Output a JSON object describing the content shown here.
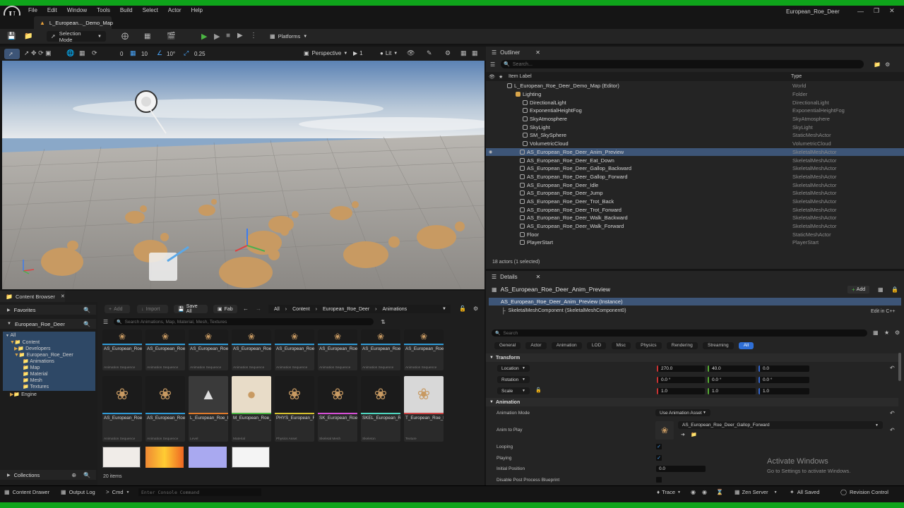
{
  "window": {
    "title": "European_Roe_Deer",
    "menu": [
      "File",
      "Edit",
      "Window",
      "Tools",
      "Build",
      "Select",
      "Actor",
      "Help"
    ]
  },
  "tab": {
    "label": "L_European..._Demo_Map"
  },
  "toolbar": {
    "selection_mode": "Selection Mode",
    "platforms": "Platforms"
  },
  "viewport_toolbar": {
    "rot_snap": "0",
    "angle": "10",
    "rot_angle": "10°",
    "scale": "0.25",
    "perspective": "Perspective",
    "camera_speed": "1",
    "lit": "Lit"
  },
  "outliner": {
    "title": "Outliner",
    "search_placeholder": "Search...",
    "col_label": "Item Label",
    "col_type": "Type",
    "rows": [
      {
        "label": "L_European_Roe_Deer_Demo_Map (Editor)",
        "type": "World"
      },
      {
        "label": "Lighting",
        "type": "Folder"
      },
      {
        "label": "DirectionalLight",
        "type": "DirectionalLight"
      },
      {
        "label": "ExponentialHeightFog",
        "type": "ExponentialHeightFog"
      },
      {
        "label": "SkyAtmosphere",
        "type": "SkyAtmosphere"
      },
      {
        "label": "SkyLight",
        "type": "SkyLight"
      },
      {
        "label": "SM_SkySphere",
        "type": "StaticMeshActor"
      },
      {
        "label": "VolumetricCloud",
        "type": "VolumetricCloud"
      },
      {
        "label": "AS_European_Roe_Deer_Anim_Preview",
        "type": "SkeletalMeshActor"
      },
      {
        "label": "AS_European_Roe_Deer_Eat_Down",
        "type": "SkeletalMeshActor"
      },
      {
        "label": "AS_European_Roe_Deer_Gallop_Backward",
        "type": "SkeletalMeshActor"
      },
      {
        "label": "AS_European_Roe_Deer_Gallop_Forward",
        "type": "SkeletalMeshActor"
      },
      {
        "label": "AS_European_Roe_Deer_Idle",
        "type": "SkeletalMeshActor"
      },
      {
        "label": "AS_European_Roe_Deer_Jump",
        "type": "SkeletalMeshActor"
      },
      {
        "label": "AS_European_Roe_Deer_Trot_Back",
        "type": "SkeletalMeshActor"
      },
      {
        "label": "AS_European_Roe_Deer_Trot_Forward",
        "type": "SkeletalMeshActor"
      },
      {
        "label": "AS_European_Roe_Deer_Walk_Backward",
        "type": "SkeletalMeshActor"
      },
      {
        "label": "AS_European_Roe_Deer_Walk_Forward",
        "type": "SkeletalMeshActor"
      },
      {
        "label": "Floor",
        "type": "StaticMeshActor"
      },
      {
        "label": "PlayerStart",
        "type": "PlayerStart"
      }
    ],
    "footer": "18 actors (1 selected)"
  },
  "details": {
    "title": "Details",
    "actor_name": "AS_European_Roe_Deer_Anim_Preview",
    "add_label": "Add",
    "instance": "AS_European_Roe_Deer_Anim_Preview (Instance)",
    "component": "SkeletalMeshComponent (SkeletalMeshComponent0)",
    "edit_cpp": "Edit in C++",
    "search_placeholder": "Search",
    "filters": [
      "General",
      "Actor",
      "Animation",
      "LOD",
      "Misc",
      "Physics",
      "Rendering",
      "Streaming",
      "All"
    ],
    "transform_label": "Transform",
    "location_label": "Location",
    "location": [
      "270.0",
      "40.0",
      "0.0"
    ],
    "rotation_label": "Rotation",
    "rotation": [
      "0.0 °",
      "0.0 °",
      "0.0 °"
    ],
    "scale_label": "Scale",
    "scale": [
      "1.0",
      "1.0",
      "1.0"
    ],
    "animation_label": "Animation",
    "anim_mode_label": "Animation Mode",
    "anim_mode": "Use Animation Asset",
    "anim_to_play_label": "Anim to Play",
    "anim_to_play": "AS_European_Roe_Deer_Gallop_Forward",
    "looping_label": "Looping",
    "playing_label": "Playing",
    "initial_position_label": "Initial Position",
    "initial_position": "0.0",
    "disable_pp_label": "Disable Post Process Blueprint",
    "watermark_title": "Activate Windows",
    "watermark_sub": "Go to Settings to activate Windows."
  },
  "content_browser": {
    "title": "Content Browser",
    "favorites": "Favorites",
    "root": "European_Roe_Deer",
    "tree": [
      "All",
      "Content",
      "Developers",
      "European_Roe_Deer",
      "Animations",
      "Map",
      "Material",
      "Mesh",
      "Textures",
      "Engine"
    ],
    "collections": "Collections",
    "add": "Add",
    "import": "Import",
    "save_all": "Save All",
    "fab": "Fab",
    "breadcrumb": [
      "All",
      "Content",
      "European_Roe_Deer",
      "Animations"
    ],
    "search_placeholder": "Search Animations, Map, Material, Mesh, Textures",
    "items_count": "20 items",
    "row1": [
      {
        "name": "AS_European_Roe_Deer_Anim_Preview",
        "type": "Animation Sequence"
      },
      {
        "name": "AS_European_Roe_Deer_Eat_Down",
        "type": "Animation Sequence"
      },
      {
        "name": "AS_European_Roe_Deer_Gallop_...",
        "type": "Animation Sequence"
      },
      {
        "name": "AS_European_Roe_Deer_Gallop_Forward",
        "type": "Animation Sequence"
      },
      {
        "name": "AS_European_Roe_Deer_Idle",
        "type": "Animation Sequence"
      },
      {
        "name": "AS_European_Roe_Deer_Jump",
        "type": "Animation Sequence"
      },
      {
        "name": "AS_European_Roe_Deer_Trot_Back",
        "type": "Animation Sequence"
      },
      {
        "name": "AS_European_Roe_Deer_Trot_Forward",
        "type": "Animation Sequence"
      }
    ],
    "row2": [
      {
        "name": "AS_European_Roe_Deer_Walk_Backward",
        "type": "Animation Sequence"
      },
      {
        "name": "AS_European_Roe_Deer_Walk_Forward",
        "type": "Animation Sequence"
      },
      {
        "name": "L_European_Roe_Deer_Demo_Map",
        "type": "Level"
      },
      {
        "name": "M_European_Roe_Deer_Female",
        "type": "Material"
      },
      {
        "name": "PHYS_European_Roe_Deer",
        "type": "Physics Asset"
      },
      {
        "name": "SK_European_Roe_Deer",
        "type": "Skeletal Mesh"
      },
      {
        "name": "SKEL_European_Roe_Deer",
        "type": "Skeleton"
      },
      {
        "name": "T_European_Roe_Deer_AO",
        "type": "Texture"
      }
    ]
  },
  "statusbar": {
    "content_drawer": "Content Drawer",
    "output_log": "Output Log",
    "cmd": "Cmd",
    "console_placeholder": "Enter Console Command",
    "trace": "Trace",
    "zen": "Zen Server",
    "saved": "All Saved",
    "revision": "Revision Control"
  }
}
